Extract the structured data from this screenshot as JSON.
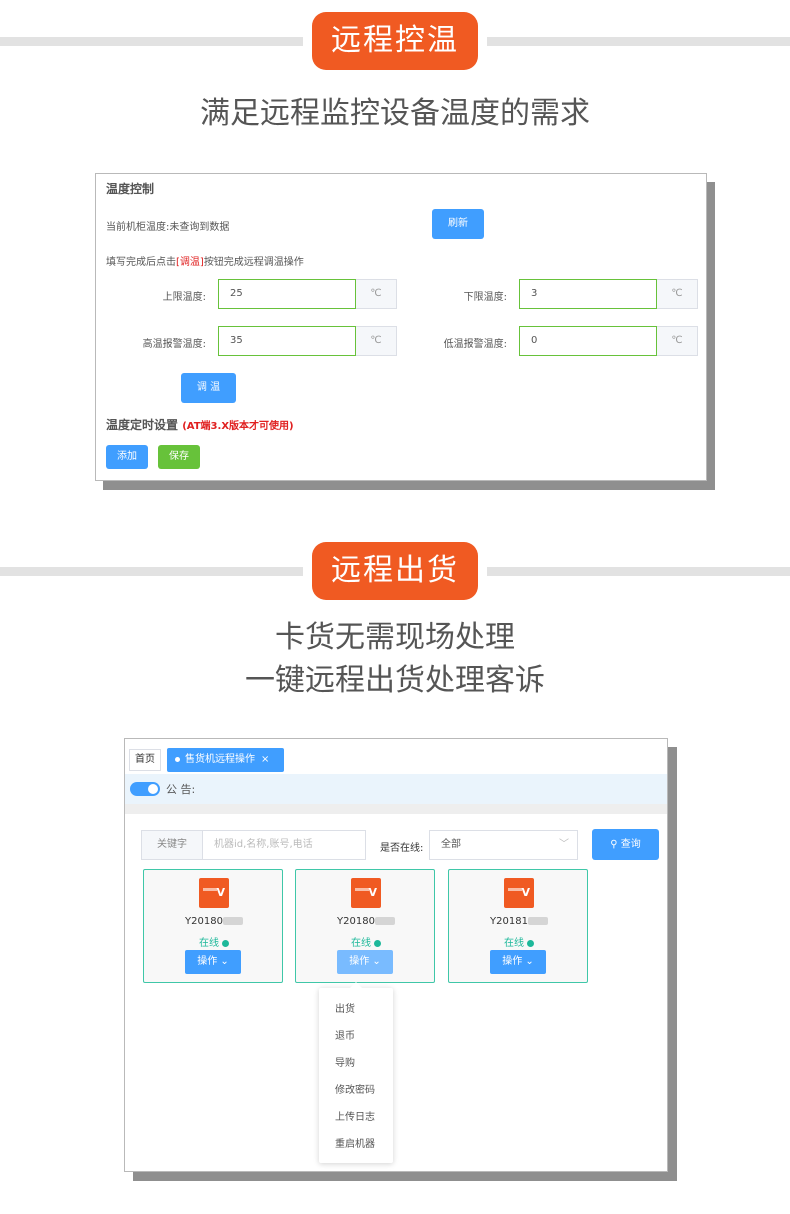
{
  "section1": {
    "badge": "远程控温",
    "subtitle": "满足远程监控设备温度的需求",
    "panel": {
      "title": "温度控制",
      "current_temp": "当前机柜温度:未查询到数据",
      "refresh_label": "刷新",
      "hint_prefix": "填写完成后点击",
      "hint_link": "[调温]",
      "hint_suffix": "按钮完成远程调温操作",
      "fields": [
        {
          "label": "上限温度:",
          "value": "25",
          "unit": "℃"
        },
        {
          "label": "下限温度:",
          "value": "3",
          "unit": "℃"
        },
        {
          "label": "高温报警温度:",
          "value": "35",
          "unit": "℃"
        },
        {
          "label": "低温报警温度:",
          "value": "0",
          "unit": "℃"
        }
      ],
      "adjust_label": "调 温",
      "timer_title": "温度定时设置",
      "timer_note": "(AT端3.X版本才可使用)",
      "add_label": "添加",
      "save_label": "保存"
    }
  },
  "section2": {
    "badge": "远程出货",
    "subtitle_line1": "卡货无需现场处理",
    "subtitle_line2": "一键远程出货处理客诉",
    "panel": {
      "tab_home": "首页",
      "tab_active": "售货机远程操作",
      "tab_close": "×",
      "notice_label": "公 告:",
      "keyword_label": "关键字",
      "keyword_placeholder": "机器id,名称,账号,电话",
      "online_label": "是否在线:",
      "online_value": "全部",
      "search_label": "查询",
      "cards": [
        {
          "id": "Y20180",
          "status": "在线",
          "op": "操作"
        },
        {
          "id": "Y20180",
          "status": "在线",
          "op": "操作"
        },
        {
          "id": "Y20181",
          "status": "在线",
          "op": "操作"
        }
      ],
      "dropdown": [
        "出货",
        "退币",
        "导购",
        "修改密码",
        "上传日志",
        "重启机器"
      ]
    }
  },
  "colors": {
    "accent_orange": "#f05a22",
    "primary_blue": "#409eff",
    "success_green": "#67c23a",
    "online_teal": "#1db89a"
  }
}
